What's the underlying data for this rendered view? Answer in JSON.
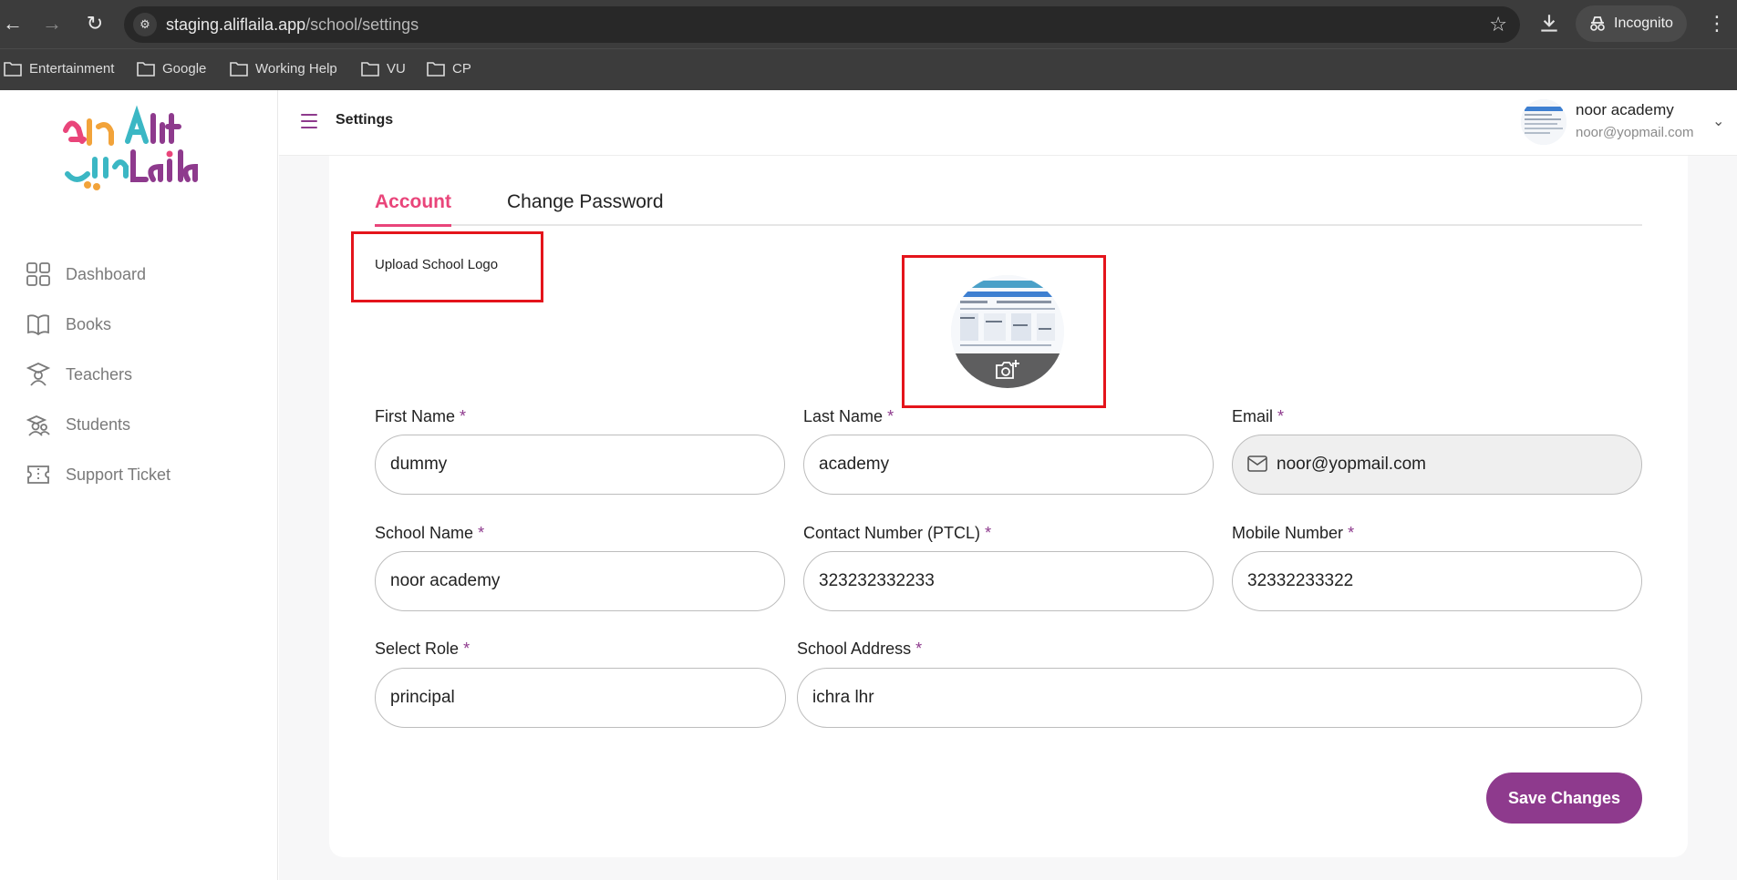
{
  "browser": {
    "url_host": "staging.aliflaila.app",
    "url_path": "/school/settings",
    "incognito_label": "Incognito",
    "bookmarks": [
      "Entertainment",
      "Google",
      "Working Help",
      "VU",
      "CP"
    ]
  },
  "sidebar": {
    "items": [
      {
        "label": "Dashboard",
        "icon": "grid-icon"
      },
      {
        "label": "Books",
        "icon": "book-icon"
      },
      {
        "label": "Teachers",
        "icon": "teacher-icon"
      },
      {
        "label": "Students",
        "icon": "students-icon"
      },
      {
        "label": "Support Ticket",
        "icon": "ticket-icon"
      }
    ]
  },
  "header": {
    "title": "Settings",
    "user_name": "noor academy",
    "user_email": "noor@yopmail.com"
  },
  "tabs": {
    "account": "Account",
    "change_password": "Change Password"
  },
  "upload": {
    "label": "Upload School Logo"
  },
  "form": {
    "first_name": {
      "label": "First Name",
      "value": "dummy"
    },
    "last_name": {
      "label": "Last Name",
      "value": "academy"
    },
    "email": {
      "label": "Email",
      "value": "noor@yopmail.com"
    },
    "school_name": {
      "label": "School Name",
      "value": "noor academy"
    },
    "contact_number": {
      "label": "Contact Number (PTCL)",
      "value": "323232332233"
    },
    "mobile_number": {
      "label": "Mobile Number",
      "value": "32332233322"
    },
    "select_role": {
      "label": "Select Role",
      "value": "principal"
    },
    "school_address": {
      "label": "School Address",
      "value": "ichra lhr"
    },
    "required_mark": "*"
  },
  "save_label": "Save Changes",
  "colors": {
    "brand_purple": "#8e3a8d",
    "tab_active_pink": "#e9457a",
    "highlight_red": "#e4141b"
  }
}
